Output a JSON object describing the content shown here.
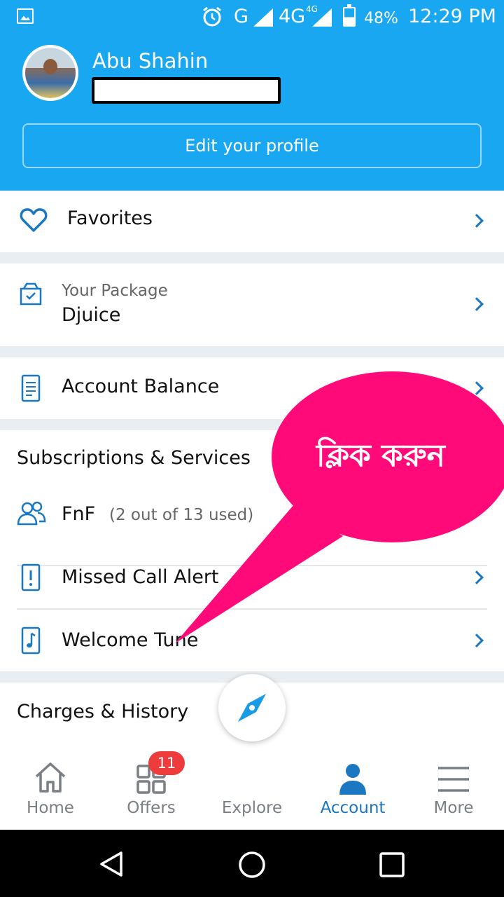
{
  "status_bar": {
    "network_g": "G",
    "network_4g": "4G",
    "network_4g_small": "4G",
    "battery": "48%",
    "time": "12:29 PM"
  },
  "profile": {
    "name": "Abu Shahin",
    "edit_button": "Edit your profile"
  },
  "favorites": {
    "label": "Favorites"
  },
  "package": {
    "caption": "Your Package",
    "value": "Djuice"
  },
  "balance": {
    "label": "Account Balance"
  },
  "subscriptions": {
    "title": "Subscriptions & Services",
    "fnf_label": "FnF",
    "fnf_usage": "(2 out of 13 used)",
    "missed_call": "Missed Call Alert",
    "welcome_tune": "Welcome Tune"
  },
  "charges": {
    "title": "Charges & History"
  },
  "callout": {
    "text": "ক্লিক করুন",
    "color": "#ff0a78"
  },
  "bottom_nav": {
    "home": "Home",
    "offers": "Offers",
    "offers_badge": "11",
    "explore": "Explore",
    "account": "Account",
    "more": "More"
  },
  "colors": {
    "brand": "#1aa7f2",
    "accent": "#1a78c2",
    "badge": "#ee3b3b"
  }
}
